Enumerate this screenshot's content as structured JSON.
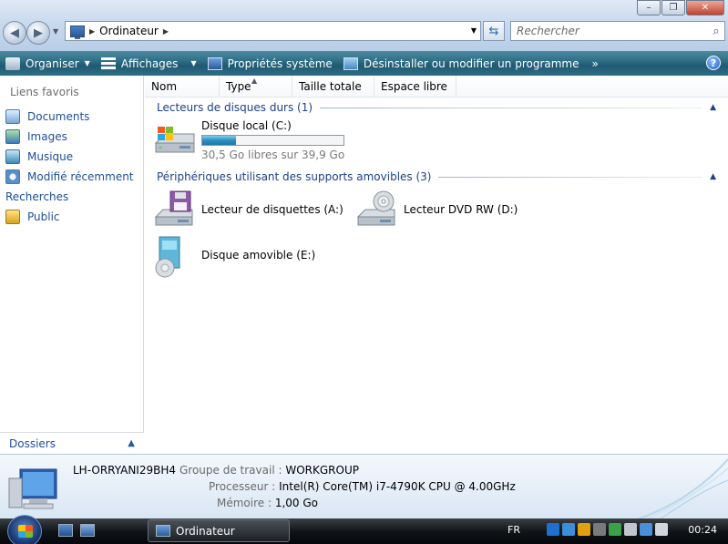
{
  "window": {
    "address": "Ordinateur",
    "search_placeholder": "Rechercher",
    "minimize": "–",
    "maximize": "❐",
    "close": "✕"
  },
  "toolbar": {
    "organize": "Organiser",
    "views": "Affichages",
    "system_properties": "Propriétés système",
    "uninstall": "Désinstaller ou modifier un programme",
    "more": "»",
    "help": "?"
  },
  "nav": {
    "title": "Liens favoris",
    "items": [
      {
        "label": "Documents",
        "icon": "documents-icon"
      },
      {
        "label": "Images",
        "icon": "images-icon"
      },
      {
        "label": "Musique",
        "icon": "music-icon"
      },
      {
        "label": "Modifié récemment",
        "icon": "recent-icon"
      },
      {
        "label": "Recherches",
        "icon": "searches-icon"
      },
      {
        "label": "Public",
        "icon": "public-folder-icon"
      }
    ],
    "folders": "Dossiers"
  },
  "columns": [
    "Nom",
    "Type",
    "Taille totale",
    "Espace libre"
  ],
  "groups": {
    "hard_drives": "Lecteurs de disques durs (1)",
    "removable": "Périphériques utilisant des supports amovibles (3)"
  },
  "drives": {
    "c": {
      "name": "Disque local (C:)",
      "free": "30,5 Go libres sur 39,9 Go",
      "used_fraction": 0.24
    },
    "floppy": {
      "name": "Lecteur de disquettes (A:)"
    },
    "dvd": {
      "name": "Lecteur DVD RW (D:)"
    },
    "removable": {
      "name": "Disque amovible (E:)"
    }
  },
  "details": {
    "computer_name": "LH-ORRYANI29BH4",
    "workgroup_label": "Groupe de travail :",
    "workgroup": "WORKGROUP",
    "cpu_label": "Processeur :",
    "cpu": "Intel(R) Core(TM) i7-4790K CPU @ 4.00GHz",
    "memory_label": "Mémoire :",
    "memory": "1,00 Go"
  },
  "taskbar": {
    "task": "Ordinateur",
    "language": "FR",
    "clock": "00:24"
  }
}
